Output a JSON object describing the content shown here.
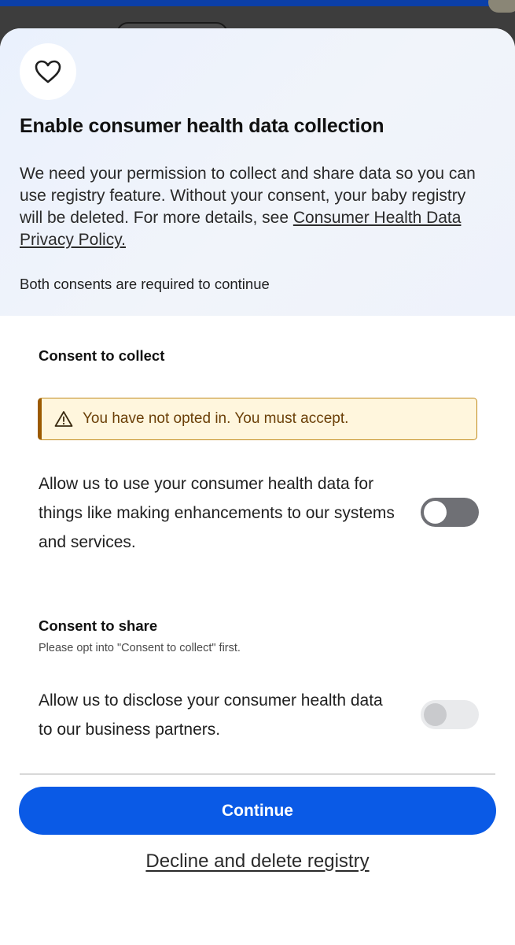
{
  "header": {
    "title": "Enable consumer health data collection",
    "description": "We need your permission to collect and share data so you can use registry feature. Without your consent, your baby registry will be deleted. For more details, see ",
    "policy_link": "Consumer Health Data Privacy Policy.",
    "requirement_note": "Both consents are required to continue",
    "icon": "heart-icon"
  },
  "collect": {
    "heading": "Consent to collect",
    "warning": "You have not opted in. You must accept.",
    "warning_icon": "warning-triangle-icon",
    "text": "Allow us to use your consumer health data for things like making enhancements to our systems and services.",
    "toggle_on": false
  },
  "share": {
    "heading": "Consent to share",
    "subtext": "Please opt into \"Consent to collect\" first.",
    "text": "Allow us to disclose your consumer health data to our business partners.",
    "toggle_on": false,
    "toggle_disabled": true
  },
  "actions": {
    "continue_label": "Continue",
    "decline_label": "Decline and delete registry"
  },
  "colors": {
    "primary": "#0a5ae6",
    "warning_bg": "#fff6dd",
    "warning_border": "#9c5a00"
  }
}
